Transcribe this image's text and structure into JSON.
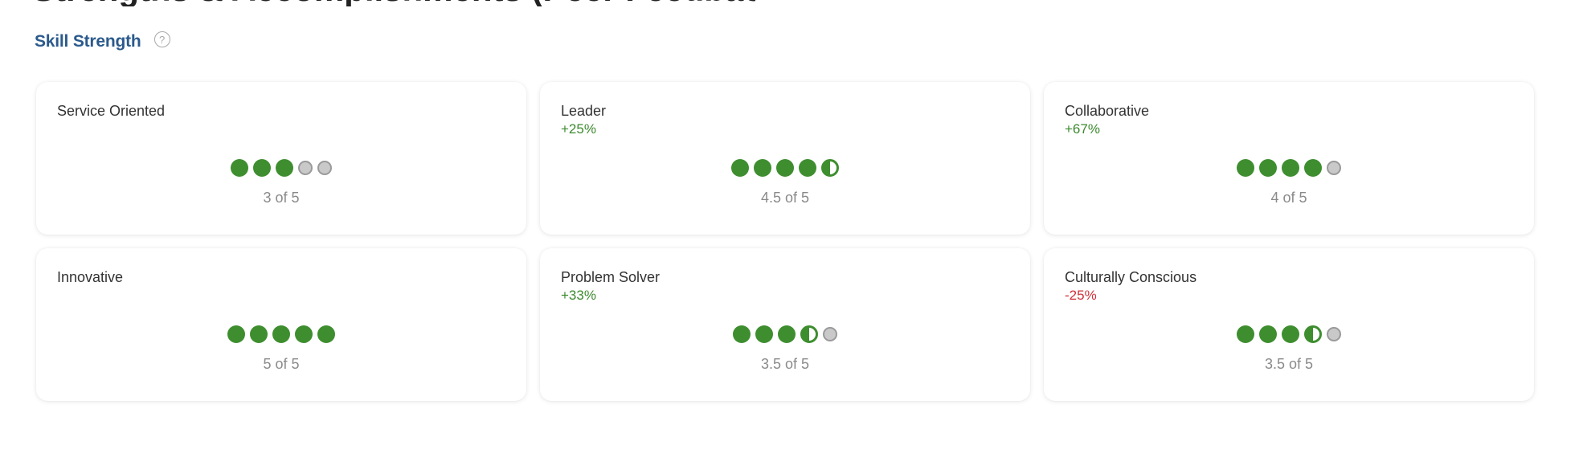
{
  "header": {
    "top_title_fragment": "Strengths & Accomplishments (Peer Feedback Summary)",
    "section_title": "Skill Strength",
    "help_glyph": "?"
  },
  "colors": {
    "accent": "#2b5a8c",
    "filled_dot": "#3e8e2f",
    "positive": "#3c8a2e",
    "negative": "#d0303a",
    "empty_dot": "#c9c9c9"
  },
  "cards": [
    {
      "title": "Service Oriented",
      "change": "",
      "change_type": "",
      "rating": 3,
      "rating_label": "3 of 5"
    },
    {
      "title": "Leader",
      "change": "+25%",
      "change_type": "pos",
      "rating": 4.5,
      "rating_label": "4.5 of 5"
    },
    {
      "title": "Collaborative",
      "change": "+67%",
      "change_type": "pos",
      "rating": 4,
      "rating_label": "4 of 5"
    },
    {
      "title": "Innovative",
      "change": "",
      "change_type": "",
      "rating": 5,
      "rating_label": "5 of 5"
    },
    {
      "title": "Problem Solver",
      "change": "+33%",
      "change_type": "pos",
      "rating": 3.5,
      "rating_label": "3.5 of 5"
    },
    {
      "title": "Culturally Conscious",
      "change": "-25%",
      "change_type": "neg",
      "rating": 3.5,
      "rating_label": "3.5 of 5"
    }
  ],
  "rating_max": 5
}
